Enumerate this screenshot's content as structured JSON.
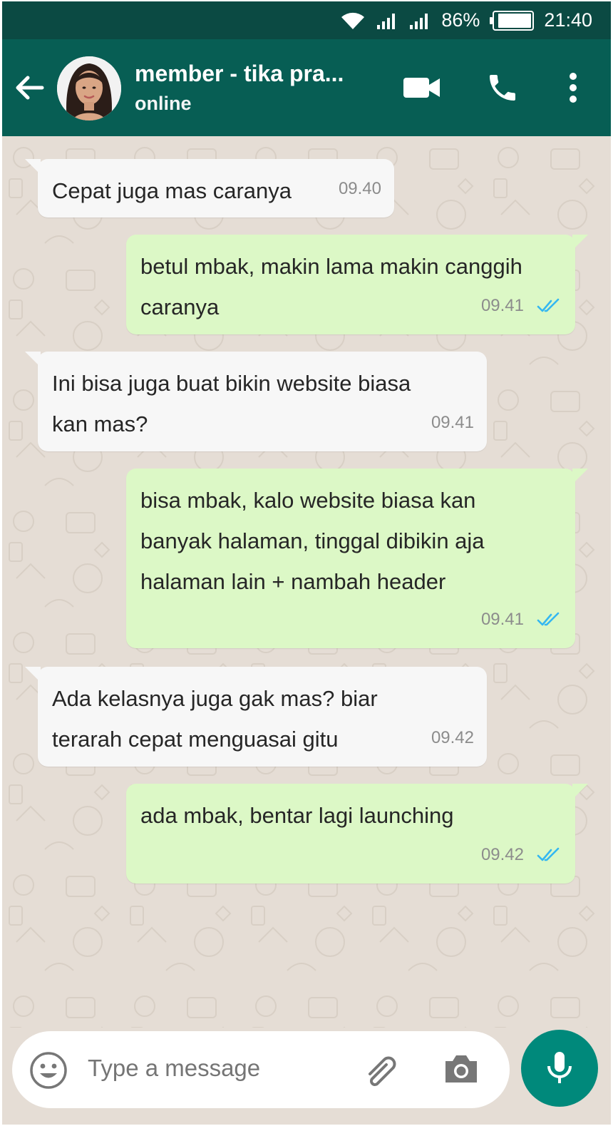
{
  "status_bar": {
    "battery_percent": "86%",
    "time": "21:40"
  },
  "header": {
    "contact_name": "member - tika pra...",
    "contact_status": "online"
  },
  "messages": [
    {
      "direction": "in",
      "lines": [
        "Cepat juga mas caranya"
      ],
      "time": "09.40"
    },
    {
      "direction": "out",
      "lines": [
        "betul mbak, makin lama makin canggih",
        "caranya"
      ],
      "time": "09.41",
      "read": true
    },
    {
      "direction": "in",
      "lines": [
        "Ini bisa juga buat bikin website biasa",
        "kan mas?"
      ],
      "time": "09.41"
    },
    {
      "direction": "out",
      "lines": [
        "bisa mbak, kalo website biasa kan",
        "banyak halaman, tinggal dibikin aja",
        "halaman lain + nambah header"
      ],
      "time": "09.41",
      "read": true
    },
    {
      "direction": "in",
      "lines": [
        "Ada kelasnya juga gak mas? biar",
        "terarah cepat menguasai gitu"
      ],
      "time": "09.42"
    },
    {
      "direction": "out",
      "lines": [
        "ada mbak, bentar lagi launching"
      ],
      "time": "09.42",
      "read": true
    }
  ],
  "composer": {
    "placeholder": "Type a message"
  },
  "colors": {
    "header": "#075e54",
    "status_bar": "#0b4a43",
    "outgoing_bubble": "#dcf8c6",
    "incoming_bubble": "#f7f7f7",
    "chat_background": "#e5ddd5",
    "read_ticks": "#34b7f1",
    "mic_button": "#00897b"
  },
  "icons": {
    "status_bar": [
      "wifi-icon",
      "signal-icon",
      "signal-icon",
      "battery-icon"
    ],
    "header": [
      "back-arrow-icon",
      "video-call-icon",
      "phone-icon",
      "more-vertical-icon"
    ],
    "composer": [
      "emoji-icon",
      "attach-icon",
      "camera-icon",
      "mic-icon"
    ]
  }
}
